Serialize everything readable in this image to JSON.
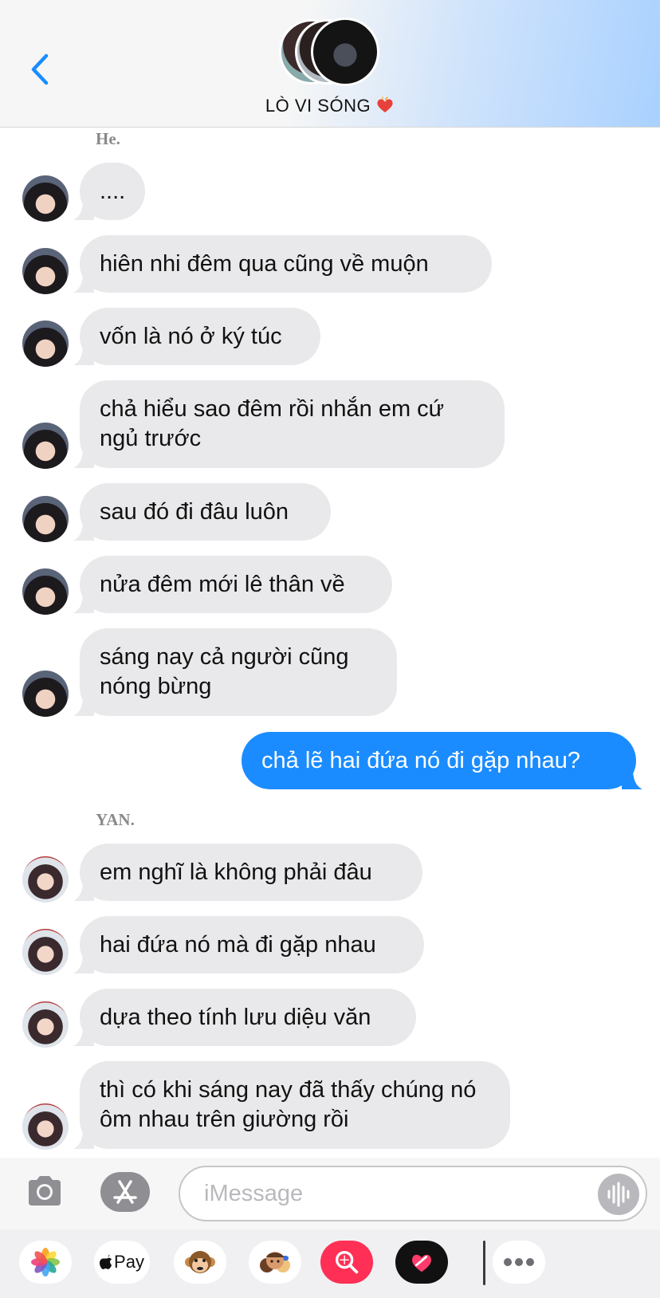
{
  "header": {
    "chat_name": "LÒ VI SÓNG",
    "heart_icon": "burning-heart-icon",
    "back_icon": "chevron-left-icon",
    "accent": "#1a8cff"
  },
  "conversation": {
    "sender_he": "He.",
    "sender_yan": "YAN.",
    "he_messages": [
      "....",
      "hiên nhi đêm qua cũng về muộn",
      "vốn là nó ở ký túc",
      "chả hiểu sao đêm rồi nhắn em cứ ngủ trước",
      "sau đó đi đâu luôn",
      "nửa đêm mới lê thân về",
      "sáng nay cả người cũng nóng bừng"
    ],
    "my_message": "chả lẽ hai đứa nó đi gặp nhau?",
    "yan_messages": [
      "em nghĩ là không phải đâu",
      "hai đứa nó mà đi gặp nhau",
      "dựa theo tính lưu diệu văn",
      "thì có khi sáng nay đã thấy chúng nó ôm nhau trên giường rồi"
    ],
    "incoming_bubble_color": "#e9e9eb",
    "outgoing_bubble_color": "#1a8cff"
  },
  "input": {
    "placeholder": "iMessage",
    "value": ""
  },
  "app_drawer": {
    "apple_pay_label": "Pay",
    "icons": [
      "photos-icon",
      "apple-pay-icon",
      "memoji-monkey-icon",
      "memoji-people-icon",
      "image-search-icon",
      "digital-touch-icon",
      "more-icon"
    ]
  }
}
